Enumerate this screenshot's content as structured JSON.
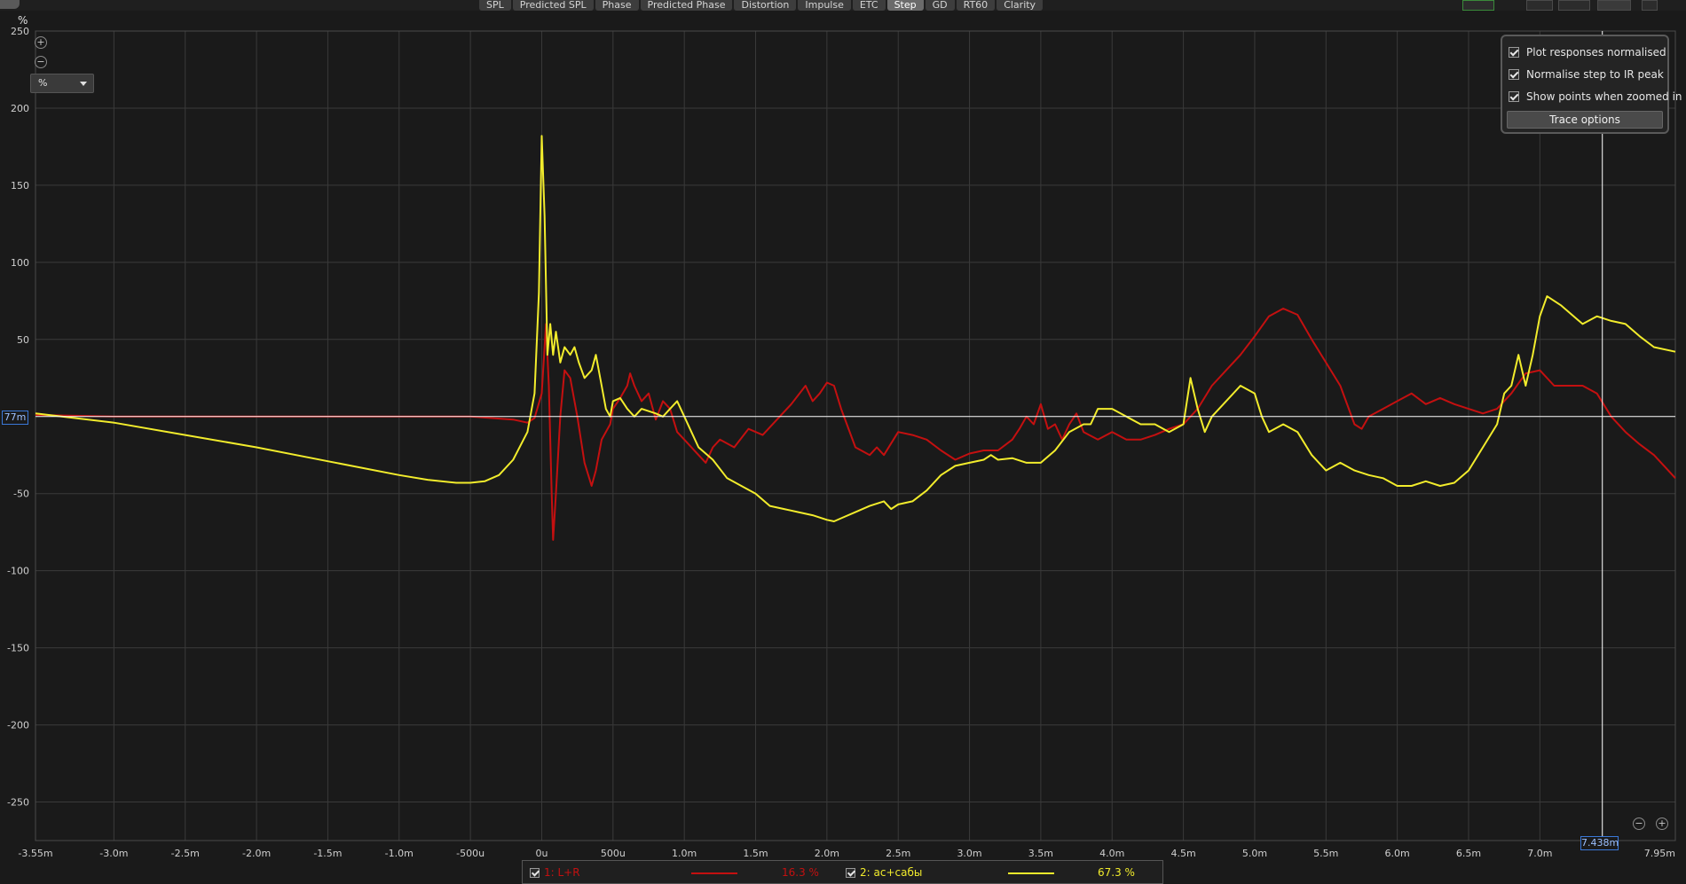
{
  "toolbar": {
    "tabs": [
      {
        "label": "SPL",
        "active": false
      },
      {
        "label": "Predicted SPL",
        "active": false
      },
      {
        "label": "Phase",
        "active": false
      },
      {
        "label": "Predicted Phase",
        "active": false
      },
      {
        "label": "Distortion",
        "active": false
      },
      {
        "label": "Impulse",
        "active": false
      },
      {
        "label": "ETC",
        "active": false
      },
      {
        "label": "Step",
        "active": true
      },
      {
        "label": "GD",
        "active": false
      },
      {
        "label": "RT60",
        "active": false
      },
      {
        "label": "Clarity",
        "active": false
      }
    ]
  },
  "y_unit_label": "%",
  "unit_select": {
    "value": "%"
  },
  "options": {
    "items": [
      {
        "label": "Plot responses normalised",
        "checked": true
      },
      {
        "label": "Normalise step to IR peak",
        "checked": true
      },
      {
        "label": "Show points when zoomed in",
        "checked": true
      }
    ],
    "trace_button": "Trace options"
  },
  "cursor": {
    "x_readout": "7.438m",
    "y_readout": "77m",
    "x_ms": 7.438,
    "color": "#ffffff"
  },
  "legend": {
    "items": [
      {
        "label": "1: L+R",
        "value": "16.3 %",
        "color": "#c41010",
        "checked": true
      },
      {
        "label": "2: ас+сабы",
        "value": "67.3 %",
        "color": "#f2ec2c",
        "checked": true
      }
    ]
  },
  "zoom_icons": {
    "zoom_in": "zoom-in-icon",
    "zoom_out": "zoom-out-icon"
  },
  "chart_data": {
    "type": "line",
    "xlabel": "",
    "ylabel": "%",
    "xlim": [
      -3.55,
      7.95
    ],
    "ylim": [
      -275,
      250
    ],
    "x_ticks": [
      -3.55,
      -3.0,
      -2.5,
      -2.0,
      -1.5,
      -1.0,
      -0.5,
      0,
      0.5,
      1.0,
      1.5,
      2.0,
      2.5,
      3.0,
      3.5,
      4.0,
      4.5,
      5.0,
      5.5,
      6.0,
      6.5,
      7.0,
      7.95
    ],
    "x_tick_labels": [
      "-3.55m",
      "-3.0m",
      "-2.5m",
      "-2.0m",
      "-1.5m",
      "-1.0m",
      "-500u",
      "0u",
      "500u",
      "1.0m",
      "1.5m",
      "2.0m",
      "2.5m",
      "3.0m",
      "3.5m",
      "4.0m",
      "4.5m",
      "5.0m",
      "5.5m",
      "6.0m",
      "6.5m",
      "7.0m",
      "7.95m"
    ],
    "y_ticks": [
      250,
      200,
      150,
      100,
      50,
      -50,
      -100,
      -150,
      -200,
      -250
    ],
    "y_tick_labels": [
      "250",
      "200",
      "150",
      "100",
      "50",
      "-50",
      "-100",
      "-150",
      "-200",
      "-250"
    ],
    "grid": true,
    "series": [
      {
        "name": "1: L+R",
        "color": "#c41010",
        "points": [
          [
            -3.55,
            1
          ],
          [
            -3.0,
            0
          ],
          [
            -2.0,
            0
          ],
          [
            -1.0,
            0
          ],
          [
            -0.5,
            0
          ],
          [
            -0.2,
            -2
          ],
          [
            -0.1,
            -4
          ],
          [
            -0.05,
            -1
          ],
          [
            0.0,
            15
          ],
          [
            0.03,
            60
          ],
          [
            0.05,
            20
          ],
          [
            0.07,
            -50
          ],
          [
            0.08,
            -80
          ],
          [
            0.1,
            -50
          ],
          [
            0.13,
            0
          ],
          [
            0.16,
            30
          ],
          [
            0.2,
            25
          ],
          [
            0.25,
            0
          ],
          [
            0.3,
            -30
          ],
          [
            0.35,
            -45
          ],
          [
            0.38,
            -35
          ],
          [
            0.42,
            -15
          ],
          [
            0.48,
            -5
          ],
          [
            0.5,
            5
          ],
          [
            0.55,
            12
          ],
          [
            0.6,
            20
          ],
          [
            0.62,
            28
          ],
          [
            0.65,
            20
          ],
          [
            0.7,
            10
          ],
          [
            0.75,
            15
          ],
          [
            0.8,
            -2
          ],
          [
            0.85,
            10
          ],
          [
            0.9,
            5
          ],
          [
            0.95,
            -10
          ],
          [
            1.0,
            -15
          ],
          [
            1.1,
            -25
          ],
          [
            1.15,
            -30
          ],
          [
            1.2,
            -20
          ],
          [
            1.25,
            -15
          ],
          [
            1.35,
            -20
          ],
          [
            1.45,
            -8
          ],
          [
            1.55,
            -12
          ],
          [
            1.65,
            -2
          ],
          [
            1.75,
            8
          ],
          [
            1.85,
            20
          ],
          [
            1.9,
            10
          ],
          [
            1.95,
            15
          ],
          [
            2.0,
            22
          ],
          [
            2.05,
            20
          ],
          [
            2.1,
            5
          ],
          [
            2.2,
            -20
          ],
          [
            2.3,
            -25
          ],
          [
            2.35,
            -20
          ],
          [
            2.4,
            -25
          ],
          [
            2.5,
            -10
          ],
          [
            2.6,
            -12
          ],
          [
            2.7,
            -15
          ],
          [
            2.8,
            -22
          ],
          [
            2.9,
            -28
          ],
          [
            3.0,
            -24
          ],
          [
            3.1,
            -22
          ],
          [
            3.2,
            -22
          ],
          [
            3.3,
            -15
          ],
          [
            3.35,
            -8
          ],
          [
            3.4,
            0
          ],
          [
            3.45,
            -5
          ],
          [
            3.5,
            8
          ],
          [
            3.55,
            -8
          ],
          [
            3.6,
            -5
          ],
          [
            3.65,
            -15
          ],
          [
            3.7,
            -5
          ],
          [
            3.75,
            2
          ],
          [
            3.8,
            -10
          ],
          [
            3.9,
            -15
          ],
          [
            4.0,
            -10
          ],
          [
            4.1,
            -15
          ],
          [
            4.2,
            -15
          ],
          [
            4.3,
            -12
          ],
          [
            4.4,
            -8
          ],
          [
            4.5,
            -5
          ],
          [
            4.6,
            5
          ],
          [
            4.7,
            20
          ],
          [
            4.8,
            30
          ],
          [
            4.9,
            40
          ],
          [
            5.0,
            52
          ],
          [
            5.1,
            65
          ],
          [
            5.2,
            70
          ],
          [
            5.3,
            66
          ],
          [
            5.4,
            50
          ],
          [
            5.5,
            35
          ],
          [
            5.6,
            20
          ],
          [
            5.7,
            -5
          ],
          [
            5.75,
            -8
          ],
          [
            5.8,
            0
          ],
          [
            5.9,
            5
          ],
          [
            6.0,
            10
          ],
          [
            6.1,
            15
          ],
          [
            6.2,
            8
          ],
          [
            6.3,
            12
          ],
          [
            6.4,
            8
          ],
          [
            6.5,
            5
          ],
          [
            6.6,
            2
          ],
          [
            6.7,
            5
          ],
          [
            6.8,
            15
          ],
          [
            6.9,
            28
          ],
          [
            7.0,
            30
          ],
          [
            7.1,
            20
          ],
          [
            7.2,
            20
          ],
          [
            7.3,
            20
          ],
          [
            7.4,
            15
          ],
          [
            7.5,
            0
          ],
          [
            7.6,
            -10
          ],
          [
            7.7,
            -18
          ],
          [
            7.8,
            -25
          ],
          [
            7.9,
            -35
          ],
          [
            7.95,
            -40
          ]
        ]
      },
      {
        "name": "2: ас+сабы",
        "color": "#f2ec2c",
        "points": [
          [
            -3.55,
            2
          ],
          [
            -3.0,
            -4
          ],
          [
            -2.5,
            -12
          ],
          [
            -2.0,
            -20
          ],
          [
            -1.5,
            -29
          ],
          [
            -1.0,
            -38
          ],
          [
            -0.8,
            -41
          ],
          [
            -0.6,
            -43
          ],
          [
            -0.5,
            -43
          ],
          [
            -0.4,
            -42
          ],
          [
            -0.3,
            -38
          ],
          [
            -0.2,
            -28
          ],
          [
            -0.1,
            -10
          ],
          [
            -0.05,
            15
          ],
          [
            -0.02,
            80
          ],
          [
            0.0,
            182
          ],
          [
            0.02,
            130
          ],
          [
            0.04,
            40
          ],
          [
            0.06,
            60
          ],
          [
            0.08,
            40
          ],
          [
            0.1,
            55
          ],
          [
            0.13,
            35
          ],
          [
            0.16,
            45
          ],
          [
            0.2,
            40
          ],
          [
            0.23,
            45
          ],
          [
            0.26,
            35
          ],
          [
            0.3,
            25
          ],
          [
            0.35,
            30
          ],
          [
            0.38,
            40
          ],
          [
            0.42,
            20
          ],
          [
            0.45,
            5
          ],
          [
            0.48,
            0
          ],
          [
            0.5,
            10
          ],
          [
            0.55,
            12
          ],
          [
            0.6,
            5
          ],
          [
            0.65,
            0
          ],
          [
            0.7,
            5
          ],
          [
            0.8,
            2
          ],
          [
            0.85,
            0
          ],
          [
            0.9,
            5
          ],
          [
            0.95,
            10
          ],
          [
            1.0,
            0
          ],
          [
            1.05,
            -10
          ],
          [
            1.1,
            -20
          ],
          [
            1.2,
            -28
          ],
          [
            1.3,
            -40
          ],
          [
            1.4,
            -45
          ],
          [
            1.5,
            -50
          ],
          [
            1.6,
            -58
          ],
          [
            1.7,
            -60
          ],
          [
            1.8,
            -62
          ],
          [
            1.9,
            -64
          ],
          [
            2.0,
            -67
          ],
          [
            2.05,
            -68
          ],
          [
            2.1,
            -66
          ],
          [
            2.2,
            -62
          ],
          [
            2.3,
            -58
          ],
          [
            2.4,
            -55
          ],
          [
            2.45,
            -60
          ],
          [
            2.5,
            -57
          ],
          [
            2.6,
            -55
          ],
          [
            2.7,
            -48
          ],
          [
            2.8,
            -38
          ],
          [
            2.9,
            -32
          ],
          [
            3.0,
            -30
          ],
          [
            3.1,
            -28
          ],
          [
            3.15,
            -25
          ],
          [
            3.2,
            -28
          ],
          [
            3.3,
            -27
          ],
          [
            3.4,
            -30
          ],
          [
            3.5,
            -30
          ],
          [
            3.6,
            -22
          ],
          [
            3.7,
            -10
          ],
          [
            3.8,
            -5
          ],
          [
            3.85,
            -5
          ],
          [
            3.9,
            5
          ],
          [
            4.0,
            5
          ],
          [
            4.1,
            0
          ],
          [
            4.2,
            -5
          ],
          [
            4.3,
            -5
          ],
          [
            4.4,
            -10
          ],
          [
            4.5,
            -5
          ],
          [
            4.55,
            25
          ],
          [
            4.6,
            5
          ],
          [
            4.65,
            -10
          ],
          [
            4.7,
            0
          ],
          [
            4.8,
            10
          ],
          [
            4.9,
            20
          ],
          [
            5.0,
            15
          ],
          [
            5.05,
            0
          ],
          [
            5.1,
            -10
          ],
          [
            5.2,
            -5
          ],
          [
            5.3,
            -10
          ],
          [
            5.4,
            -25
          ],
          [
            5.5,
            -35
          ],
          [
            5.6,
            -30
          ],
          [
            5.7,
            -35
          ],
          [
            5.8,
            -38
          ],
          [
            5.9,
            -40
          ],
          [
            6.0,
            -45
          ],
          [
            6.1,
            -45
          ],
          [
            6.2,
            -42
          ],
          [
            6.3,
            -45
          ],
          [
            6.4,
            -43
          ],
          [
            6.5,
            -35
          ],
          [
            6.6,
            -20
          ],
          [
            6.7,
            -5
          ],
          [
            6.75,
            15
          ],
          [
            6.8,
            20
          ],
          [
            6.85,
            40
          ],
          [
            6.9,
            20
          ],
          [
            6.95,
            40
          ],
          [
            7.0,
            65
          ],
          [
            7.05,
            78
          ],
          [
            7.15,
            72
          ],
          [
            7.3,
            60
          ],
          [
            7.4,
            65
          ],
          [
            7.5,
            62
          ],
          [
            7.6,
            60
          ],
          [
            7.7,
            52
          ],
          [
            7.8,
            45
          ],
          [
            7.95,
            42
          ]
        ]
      }
    ]
  }
}
